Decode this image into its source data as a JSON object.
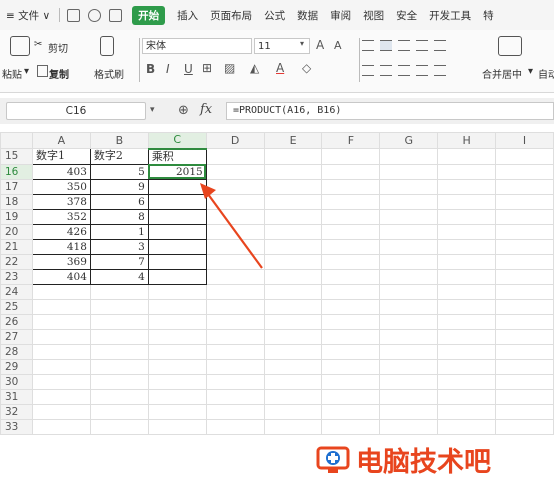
{
  "menubar": {
    "items": [
      "≡ 文件 ∨",
      "开始",
      "插入",
      "页面布局",
      "公式",
      "数据",
      "审阅",
      "视图",
      "安全",
      "开发工具",
      "特"
    ]
  },
  "ribbon": {
    "paste": "粘贴",
    "cut": "剪切",
    "copy": "复制",
    "format_painter": "格式刷",
    "font_name": "宋体",
    "font_size": "11",
    "merge": "合并居中",
    "auto": "自动"
  },
  "formula_bar": {
    "name_box": "C16",
    "fx": "fx",
    "formula": "=PRODUCT(A16, B16)"
  },
  "sheet": {
    "columns": [
      "A",
      "B",
      "C",
      "D",
      "E",
      "F",
      "G",
      "H",
      "I"
    ],
    "rows": [
      {
        "n": "15",
        "a": "数字1",
        "b": "数字2",
        "c": "乘积"
      },
      {
        "n": "16",
        "a": "403",
        "b": "5",
        "c": "2015"
      },
      {
        "n": "17",
        "a": "350",
        "b": "9",
        "c": ""
      },
      {
        "n": "18",
        "a": "378",
        "b": "6",
        "c": ""
      },
      {
        "n": "19",
        "a": "352",
        "b": "8",
        "c": ""
      },
      {
        "n": "20",
        "a": "426",
        "b": "1",
        "c": ""
      },
      {
        "n": "21",
        "a": "418",
        "b": "3",
        "c": ""
      },
      {
        "n": "22",
        "a": "369",
        "b": "7",
        "c": ""
      },
      {
        "n": "23",
        "a": "404",
        "b": "4",
        "c": ""
      },
      {
        "n": "24"
      },
      {
        "n": "25"
      },
      {
        "n": "26"
      },
      {
        "n": "27"
      },
      {
        "n": "28"
      },
      {
        "n": "29"
      },
      {
        "n": "30"
      },
      {
        "n": "31"
      },
      {
        "n": "32"
      },
      {
        "n": "33"
      }
    ]
  },
  "watermark": "电脑技术吧",
  "colors": {
    "accent": "#2e9b4a",
    "arrow": "#e8451e"
  }
}
